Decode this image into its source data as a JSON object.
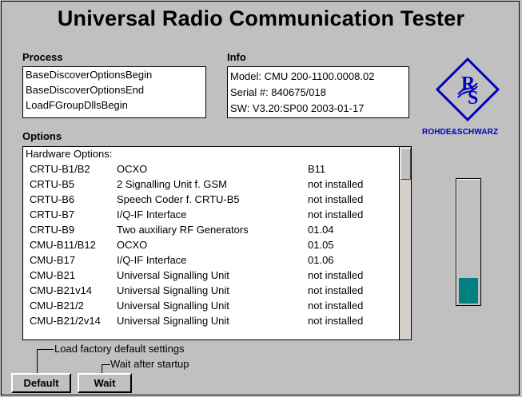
{
  "title": "Universal Radio Communication Tester",
  "process": {
    "label": "Process",
    "lines": [
      "BaseDiscoverOptionsBegin",
      "BaseDiscoverOptionsEnd",
      "LoadFGroupDllsBegin"
    ]
  },
  "info": {
    "label": "Info",
    "lines": [
      "Model: CMU 200-1100.0008.02",
      "Serial #: 840675/018",
      "SW: V3.20:SP00 2003-01-17"
    ]
  },
  "options": {
    "label": "Options",
    "header": "Hardware Options:",
    "rows": [
      {
        "code": "CRTU-B1/B2",
        "desc": "OCXO",
        "status": "B11"
      },
      {
        "code": "CRTU-B5",
        "desc": "2 Signalling Unit f. GSM",
        "status": "not installed"
      },
      {
        "code": "CRTU-B6",
        "desc": "Speech Coder f. CRTU-B5",
        "status": "not installed"
      },
      {
        "code": "CRTU-B7",
        "desc": "I/Q-IF Interface",
        "status": "not installed"
      },
      {
        "code": "CRTU-B9",
        "desc": "Two auxiliary RF Generators",
        "status": "01.04"
      },
      {
        "code": "CMU-B11/B12",
        "desc": "OCXO",
        "status": "01.05"
      },
      {
        "code": "CMU-B17",
        "desc": "I/Q-IF Interface",
        "status": "01.06"
      },
      {
        "code": "CMU-B21",
        "desc": "Universal Signalling Unit",
        "status": "not installed"
      },
      {
        "code": "CMU-B21v14",
        "desc": "Universal Signalling Unit",
        "status": "not installed"
      },
      {
        "code": "CMU-B21/2",
        "desc": "Universal Signalling Unit",
        "status": "not installed"
      },
      {
        "code": "CMU-B21/2v14",
        "desc": "Universal Signalling Unit",
        "status": "not installed"
      }
    ]
  },
  "brand": {
    "name": "ROHDE&SCHWARZ",
    "logo_text": "R&S",
    "color": "#0000c0"
  },
  "progress": {
    "fraction": 0.21,
    "color": "#008080"
  },
  "hints": {
    "default": "Load factory default settings",
    "wait": "Wait after startup"
  },
  "buttons": {
    "default": "Default",
    "wait": "Wait"
  }
}
